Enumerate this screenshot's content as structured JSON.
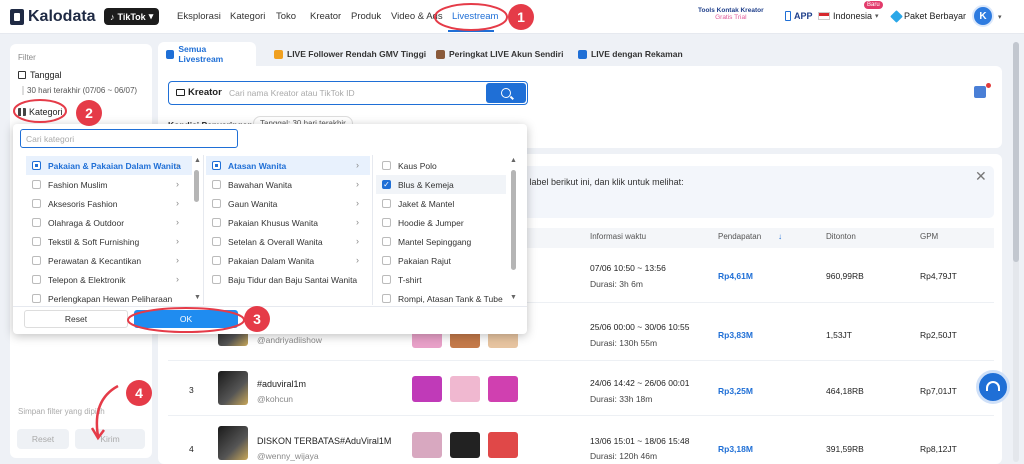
{
  "nav": {
    "logo": "Kalodata",
    "platform": "TikTok",
    "items": [
      "Eksplorasi",
      "Kategori",
      "Toko",
      "Kreator",
      "Produk",
      "Video & Ads",
      "Livestream"
    ],
    "tools_title": "Tools Kontak Kreator",
    "tools_sub": "Gratis Trial",
    "app": "APP",
    "country": "Indonesia",
    "new_badge": "Baru",
    "plan": "Paket Berbayar",
    "avatar_initial": "K"
  },
  "sidebar": {
    "filter_label": "Filter",
    "date_label": "Tanggal",
    "date_value": "30 hari terakhir (07/06 ~ 06/07)",
    "category_label": "Kategori",
    "save_filter": "Simpan filter yang dipilih",
    "reset": "Reset",
    "submit": "Kirim"
  },
  "tabs": [
    {
      "label": "Semua Livestream",
      "color": "#1f6fd6"
    },
    {
      "label": "LIVE Follower Rendah GMV Tinggi",
      "color": "#f0a020"
    },
    {
      "label": "Peringkat LIVE Akun Sendiri",
      "color": "#8a5a3a"
    },
    {
      "label": "LIVE dengan Rekaman",
      "color": "#1f6fd6"
    }
  ],
  "search": {
    "type_label": "Kreator",
    "placeholder": "Cari nama Kreator atau TikTok ID",
    "condition_label": "Kondisi Penyaringan",
    "condition_chip": "Tanggal: 30 hari terakhir"
  },
  "banner": {
    "text": "ai label berikut ini, dan klik untuk melihat:"
  },
  "table": {
    "headers": [
      "Informasi waktu",
      "Pendapatan",
      "Ditonton",
      "GPM"
    ],
    "rows": [
      {
        "rank": "",
        "name": "",
        "handle": "",
        "time": "07/06 10:50 ~ 13:56",
        "duration": "Durasi: 3h 6m",
        "revenue": "Rp4,61M",
        "views": "960,99RB",
        "gpm": "Rp4,79JT"
      },
      {
        "rank": "",
        "name": "",
        "handle": "@andriyadiishow",
        "time": "25/06 00:00 ~ 30/06 10:55",
        "duration": "Durasi: 130h 55m",
        "revenue": "Rp3,83M",
        "views": "1,53JT",
        "gpm": "Rp2,50JT"
      },
      {
        "rank": "3",
        "name": "#aduviral1m",
        "handle": "@kohcun",
        "time": "24/06 14:42 ~ 26/06 00:01",
        "duration": "Durasi: 33h 18m",
        "revenue": "Rp3,25M",
        "views": "464,18RB",
        "gpm": "Rp7,01JT"
      },
      {
        "rank": "4",
        "name": "DISKON TERBATAS#AduViral1M",
        "handle": "@wenny_wijaya",
        "time": "13/06 15:01 ~ 18/06 15:48",
        "duration": "Durasi: 120h 46m",
        "revenue": "Rp3,18M",
        "views": "391,59RB",
        "gpm": "Rp8,12JT"
      }
    ]
  },
  "dropdown": {
    "search_placeholder": "Cari kategori",
    "col1": [
      "Pakaian & Pakaian Dalam Wanita",
      "Fashion Muslim",
      "Aksesoris Fashion",
      "Olahraga & Outdoor",
      "Tekstil & Soft Furnishing",
      "Perawatan & Kecantikan",
      "Telepon & Elektronik",
      "Perlengkapan Hewan Peliharaan"
    ],
    "col2": [
      "Atasan Wanita",
      "Bawahan Wanita",
      "Gaun Wanita",
      "Pakaian Khusus Wanita",
      "Setelan & Overall Wanita",
      "Pakaian Dalam Wanita",
      "Baju Tidur dan Baju Santai Wanita"
    ],
    "col3": [
      "Kaus Polo",
      "Blus & Kemeja",
      "Jaket & Mantel",
      "Hoodie & Jumper",
      "Mantel Sepinggang",
      "Pakaian Rajut",
      "T-shirt",
      "Rompi, Atasan Tank & Tube"
    ],
    "reset": "Reset",
    "ok": "OK"
  },
  "annotations": [
    "1",
    "2",
    "3",
    "4"
  ]
}
